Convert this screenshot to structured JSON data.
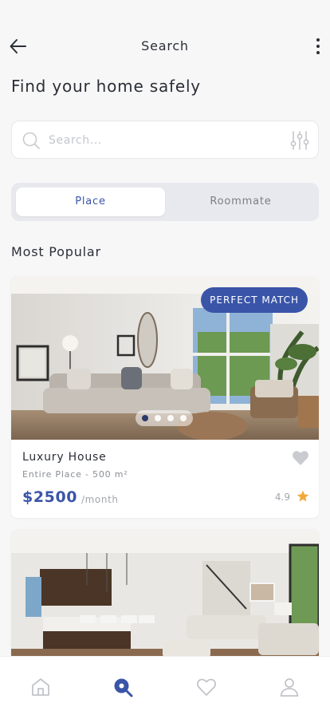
{
  "header": {
    "title": "Search",
    "back_icon": "arrow-left-icon",
    "more_icon": "more-vertical-icon"
  },
  "heading": "Find your home safely",
  "search": {
    "placeholder": "Search...",
    "value": "",
    "icon": "search-icon",
    "filter_icon": "sliders-icon"
  },
  "segments": [
    {
      "label": "Place",
      "active": true
    },
    {
      "label": "Roommate",
      "active": false
    }
  ],
  "section_title": "Most Popular",
  "listings": [
    {
      "badge": "PERFECT MATCH",
      "name": "Luxury House",
      "subtitle": "Entire Place - 500 m²",
      "price": "$2500",
      "period": "/month",
      "rating": "4.9",
      "slides": 4,
      "active_slide": 1
    }
  ],
  "tabbar": [
    {
      "icon": "home-icon",
      "active": false
    },
    {
      "icon": "search-icon",
      "active": true
    },
    {
      "icon": "heart-icon",
      "active": false
    },
    {
      "icon": "user-icon",
      "active": false
    }
  ],
  "colors": {
    "accent": "#3a55a8",
    "star": "#f2a93b",
    "background": "#f7f7f8"
  }
}
